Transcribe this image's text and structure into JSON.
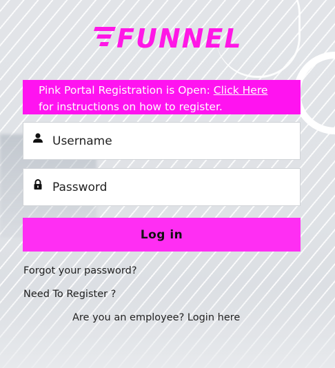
{
  "brand": {
    "name": "FUNNEL",
    "color": "#ff17e6"
  },
  "notice": {
    "text_before": "Pink Portal Registration is Open: ",
    "link_label": "Click Here",
    "text_after": "for instructions on how to register."
  },
  "form": {
    "username": {
      "placeholder": "Username",
      "value": "",
      "icon": "user-icon"
    },
    "password": {
      "placeholder": "Password",
      "value": "",
      "icon": "lock-icon"
    },
    "login_label": "Log in"
  },
  "links": {
    "forgot_password": "Forgot your password?",
    "register": "Need To Register ?",
    "employee_login": "Are you an employee? Login here"
  },
  "colors": {
    "accent": "#ff13f0",
    "button": "#ff2ef3"
  }
}
